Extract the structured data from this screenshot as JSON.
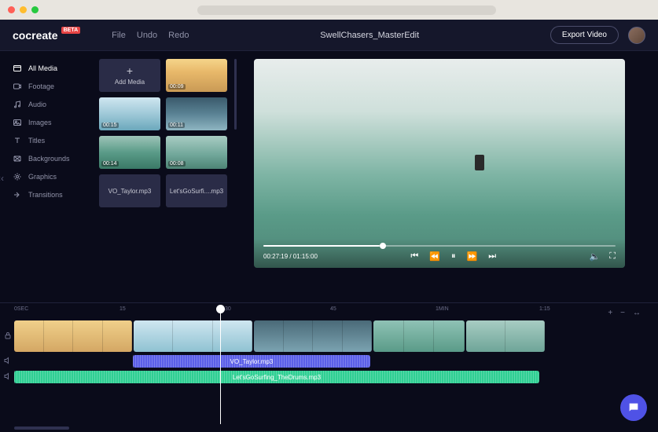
{
  "brand": {
    "name": "cocreate",
    "badge": "BETA"
  },
  "menu": {
    "file": "File",
    "undo": "Undo",
    "redo": "Redo"
  },
  "project_title": "SwellChasers_MasterEdit",
  "export_label": "Export Video",
  "sidebar": {
    "items": [
      {
        "label": "All Media"
      },
      {
        "label": "Footage"
      },
      {
        "label": "Audio"
      },
      {
        "label": "Images"
      },
      {
        "label": "Titles"
      },
      {
        "label": "Backgrounds"
      },
      {
        "label": "Graphics"
      },
      {
        "label": "Transitions"
      }
    ]
  },
  "media": {
    "add_label": "Add Media",
    "clips": [
      {
        "dur": "00:09"
      },
      {
        "dur": "00:15"
      },
      {
        "dur": "00:11"
      },
      {
        "dur": "00:14"
      },
      {
        "dur": "00:08"
      }
    ],
    "audio1": "VO_Taylor.mp3",
    "audio2": "Let'sGoSurfi....mp3"
  },
  "preview": {
    "time": "00:27:19 / 01:15:00"
  },
  "timeline": {
    "ticks": [
      "0SEC",
      "15",
      "30",
      "45",
      "1MIN",
      "1:15"
    ],
    "audio_vo": "VO_Taylor.mp3",
    "audio_music": "Let'sGoSurfing_TheDrums.mp3"
  }
}
